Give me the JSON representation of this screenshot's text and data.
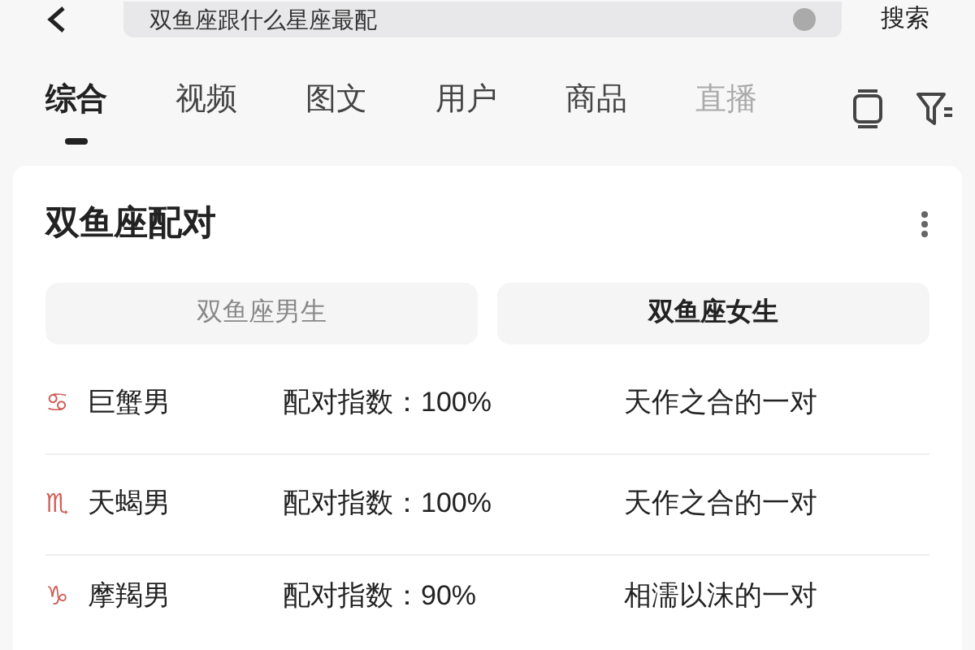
{
  "search": {
    "value": "双鱼座跟什么星座最配",
    "button": "搜索"
  },
  "tabs": [
    {
      "label": "综合",
      "selected": true
    },
    {
      "label": "视频",
      "selected": false
    },
    {
      "label": "图文",
      "selected": false
    },
    {
      "label": "用户",
      "selected": false
    },
    {
      "label": "商品",
      "selected": false
    },
    {
      "label": "直播",
      "selected": false
    }
  ],
  "card": {
    "title": "双鱼座配对",
    "toggle": [
      {
        "label": "双鱼座男生",
        "selected": false
      },
      {
        "label": "双鱼座女生",
        "selected": true
      }
    ],
    "rows": [
      {
        "symbol": "♋",
        "sign": "巨蟹男",
        "score": "配对指数：100%",
        "comment": "天作之合的一对"
      },
      {
        "symbol": "♏",
        "sign": "天蝎男",
        "score": "配对指数：100%",
        "comment": "天作之合的一对"
      },
      {
        "symbol": "♑",
        "sign": "摩羯男",
        "score": "配对指数：90%",
        "comment": "相濡以沫的一对"
      }
    ]
  }
}
